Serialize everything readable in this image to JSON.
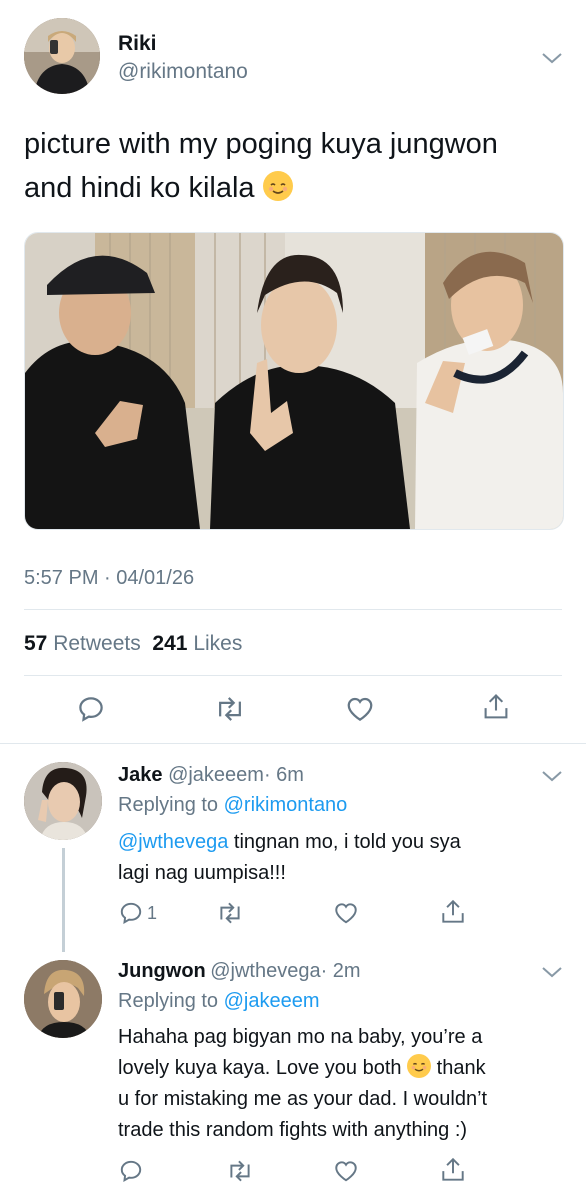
{
  "tweet": {
    "author": {
      "name": "Riki",
      "handle": "@rikimontano"
    },
    "text_line1": "picture with my poging kuya jungwon",
    "text_line2": "and hindi ko kilala",
    "emoji": "relieved-face-emoji",
    "time": "5:57 PM · 04/01/26",
    "retweets_count": "57",
    "retweets_label": "Retweets",
    "likes_count": "241",
    "likes_label": "Likes",
    "actions": [
      "reply-icon",
      "retweet-icon",
      "like-icon",
      "share-icon"
    ]
  },
  "replies": [
    {
      "name": "Jake",
      "handle": "@jakeeem",
      "time": "· 6m",
      "replying_label": "Replying to",
      "replying_to": "@rikimontano",
      "mention": "@jwthevega",
      "line1_rest": " tingnan mo, i told you sya",
      "line2": "lagi nag uumpisa!!!",
      "reply_count": "1"
    },
    {
      "name": "Jungwon",
      "handle": "@jwthevega",
      "time": "· 2m",
      "replying_label": "Replying to",
      "replying_to": "@jakeeem",
      "line1": "Hahaha pag bigyan mo na baby, you’re a",
      "line2a": "lovely kuya kaya. Love you both",
      "line2b": "thank",
      "line3": "u for mistaking me as your dad. I wouldn’t",
      "line4": "trade this random fights with anything :)"
    }
  ],
  "colors": {
    "link": "#1d9bf0",
    "secondary": "#657786",
    "divider": "#e1e8ed"
  }
}
